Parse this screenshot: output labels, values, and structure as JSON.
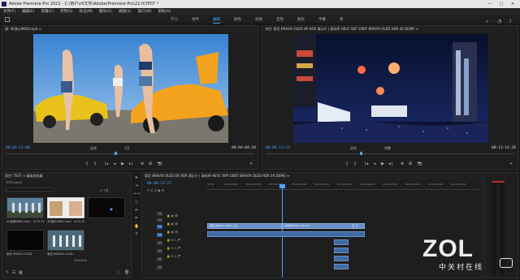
{
  "titlebar": {
    "title": "Adobe Premiere Pro 2022 - C:\\用户\\rfi文件\\Adobe\\Premiere Pro\\22.0\\TEST *",
    "minimize": "—",
    "maximize": "□",
    "close": "✕"
  },
  "menu": [
    "文件(F)",
    "编辑(E)",
    "剪辑(C)",
    "序列(S)",
    "标记(M)",
    "图形(G)",
    "视图(V)",
    "窗口(W)",
    "帮助(H)"
  ],
  "workspaces": [
    "学习",
    "组件",
    "编辑",
    "颜色",
    "效果",
    "音频",
    "图形",
    "字幕",
    "库"
  ],
  "active_workspace": "编辑",
  "source": {
    "header": "源: 4K演示8K60.mp4 ≡",
    "timecode_in": "00:03:11:08",
    "timecode_out": "00:04:04:10",
    "fit": "适合",
    "fraction": "1/2"
  },
  "program": {
    "header": "节目: 索尼 BRAVIA OLED 4K HDR 演示片 | 高码率 HEVC 60P 10BIT BRAVIA OLED HDR 4K DEMO ≡",
    "timecode_in": "00:06:13:23",
    "timecode_out": "00:13:14:20",
    "fit": "适合",
    "fraction": "完整"
  },
  "transport": [
    "⇤",
    "{",
    "}",
    "|◂",
    "◂",
    "▶",
    "▸|",
    "⊕",
    "⊞",
    "📷",
    "+"
  ],
  "project": {
    "header": "项目: TEST ≡   媒体浏览器",
    "file": "TEST.prproj",
    "item_count": "4 个项",
    "items": [
      {
        "label": "4K高清8K60.mp4",
        "duration": "3:03:15"
      },
      {
        "label": "4K演示8K60.mp4",
        "duration": "4:04:10"
      },
      {
        "label": "索尼 BRAVIA OLED",
        "duration": "13:14:20"
      },
      {
        "label": "索尼 BRAVIA OLED...",
        "duration": "13:14:20"
      }
    ]
  },
  "timeline": {
    "header": "索尼 BRAVIA OLED 4K HDR 演示片 | 高码率 HEVC 60P 10BIT BRAVIA OLED HDR 4K DEMO ≡",
    "timecode": "00:06:13:23",
    "ruler": [
      "00:00",
      "00:02:00:00",
      "00:04:00:00",
      "00:06:00:00",
      "00:08:00:00",
      "00:10:00:00",
      "00:12:00:00",
      "00:14:00:00",
      "00:16:00:00",
      "00:18:00:00",
      "00:20:00:00",
      "00:22:00:00"
    ],
    "tracks": [
      "V3",
      "V2",
      "V1",
      "A1",
      "A2",
      "A3",
      "A4",
      "A5"
    ],
    "clip1": "索尼 BRAVIA OLED...[V]",
    "clip2": "4K演示8K60.mp4 [V]",
    "clip3": "fx"
  },
  "watermark": {
    "main": "ZOL",
    "sub": "中关村在线"
  },
  "colors": {
    "accent": "#4aa3ff",
    "clip_video": "#6a8fc4",
    "clip_audio": "#3f6aa3"
  }
}
